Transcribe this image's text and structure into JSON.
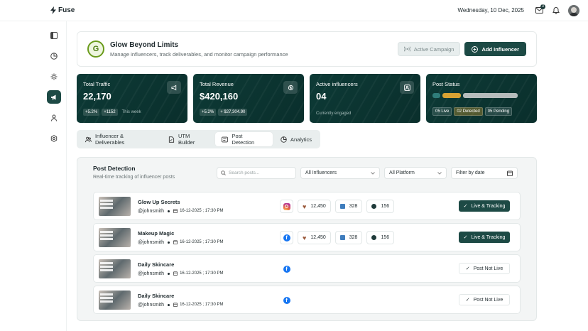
{
  "app": {
    "name": "Fuse"
  },
  "header": {
    "date": "Wednesday, 10 Dec, 2025",
    "mail_count": "3"
  },
  "campaign": {
    "initial": "G",
    "title": "Glow Beyond Limits",
    "subtitle": "Manage influencers, track deliverables, and monitor campaign performance",
    "active_label": "Active Campaign",
    "add_label": "Add Influencer"
  },
  "stats": [
    {
      "label": "Total Traffic",
      "value": "22,170",
      "chips": [
        "+5.2%",
        "+1152"
      ],
      "note": "This week"
    },
    {
      "label": "Total Revenue",
      "value": "$420,160",
      "chips": [
        "+5.2%",
        "+ $27,304.90"
      ],
      "note": ""
    },
    {
      "label": "Active influencers",
      "value": "04",
      "chips": [],
      "note": "Currently engaged"
    },
    {
      "label": "Post Status",
      "value": "",
      "chips": [
        "05 Live",
        "02 Detected",
        "05 Pending"
      ],
      "note": ""
    }
  ],
  "post_status_fractions": {
    "live": 0.08,
    "detected": 0.19,
    "pending": 0.57
  },
  "tabs": [
    {
      "label": "Influencer & Deliverables"
    },
    {
      "label": "UTM Builder"
    },
    {
      "label": "Post Detection"
    },
    {
      "label": "Analytics"
    }
  ],
  "panel": {
    "title": "Post Detection",
    "subtitle": "Real-time tracking of influencer posts",
    "search_placeholder": "Search posts...",
    "filter_influencers": "All Influencers",
    "filter_platform": "All Platform",
    "filter_date": "Filter by date"
  },
  "posts": [
    {
      "title": "Glow Up Secrets",
      "handle": "@johnsmith",
      "time": "16-12-2025 ; 17:30 PM",
      "platform": "instagram",
      "likes": "12,450",
      "shares": "328",
      "comments": "156",
      "status": "Live & Tracking"
    },
    {
      "title": "Makeup Magic",
      "handle": "@johnsmith",
      "time": "16-12-2025 ; 17:30 PM",
      "platform": "facebook",
      "likes": "12,450",
      "shares": "328",
      "comments": "156",
      "status": "Live & Tracking"
    },
    {
      "title": "Daily Skincare",
      "handle": "@johnsmith",
      "time": "16-12-2025 ; 17:30 PM",
      "platform": "facebook",
      "status": "Post Not Live"
    },
    {
      "title": "Daily Skincare",
      "handle": "@johnsmith",
      "time": "16-12-2025 ; 17:30 PM",
      "platform": "facebook",
      "status": "Post Not Live"
    }
  ]
}
